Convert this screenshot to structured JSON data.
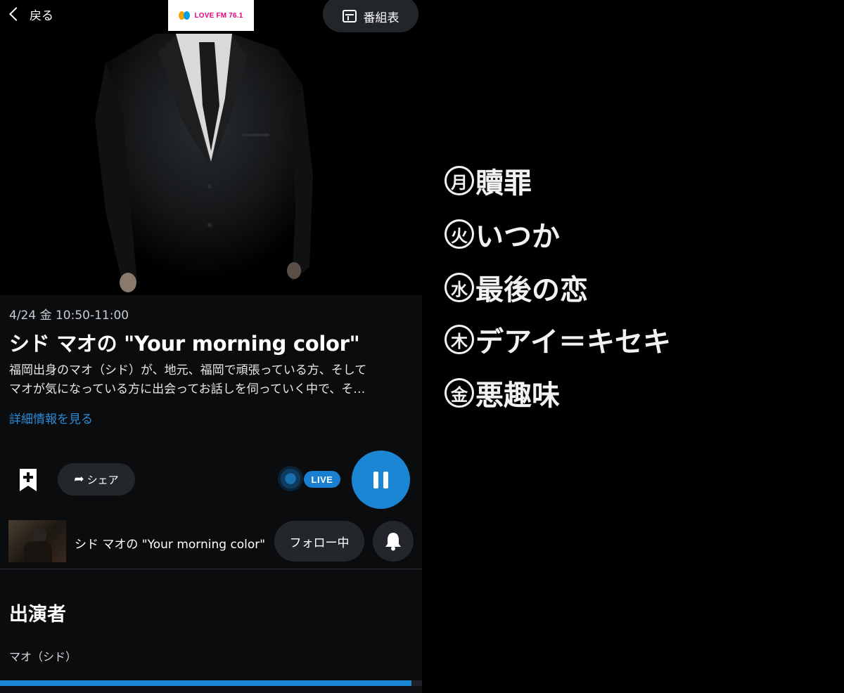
{
  "header": {
    "back_label": "戻る",
    "logo_text": "LOVE FM 76.1",
    "schedule_label": "番組表"
  },
  "program": {
    "datetime": "4/24 金 10:50-11:00",
    "title": "シド マオの \"Your morning color\"",
    "description_line1": "福岡出身のマオ（シド）が、地元、福岡で頑張っている方、そして",
    "description_line2": "マオが気になっている方に出会ってお話しを伺っていく中で、そ…",
    "more_link": "詳細情報を見る"
  },
  "actions": {
    "share_label": "シェア",
    "live_label": "LIVE"
  },
  "follow": {
    "name": "シド マオの \"Your morning color\"",
    "follow_label": "フォロー中"
  },
  "cast": {
    "heading": "出演者",
    "name": "マオ（シド）"
  },
  "playback": {
    "progress_fraction": 0.975
  },
  "days": [
    {
      "circle": "月",
      "song": "贖罪"
    },
    {
      "circle": "火",
      "song": "いつか"
    },
    {
      "circle": "水",
      "song": "最後の恋"
    },
    {
      "circle": "木",
      "song": "デアイ＝キセキ"
    },
    {
      "circle": "金",
      "song": "悪趣味"
    }
  ],
  "colors": {
    "accent": "#1b86d4",
    "link": "#2b8bd6",
    "logo_pink": "#e5007f",
    "background": "#0a0c0e"
  }
}
